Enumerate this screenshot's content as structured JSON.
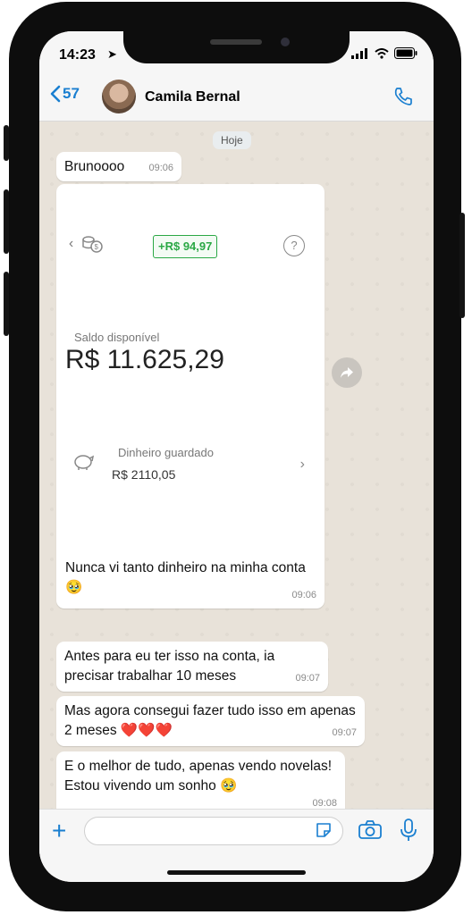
{
  "status": {
    "time": "14:23"
  },
  "header": {
    "back_count": "57",
    "contact_name": "Camila Bernal"
  },
  "chat": {
    "date_chip": "Hoje",
    "messages": [
      {
        "text": "Brunoooo",
        "time": "09:06"
      },
      {
        "text": "Nunca vi tanto dinheiro na minha conta 🥹",
        "time": "09:06"
      },
      {
        "text": "Antes para eu ter isso na conta, ia precisar trabalhar 10 meses",
        "time": "09:07"
      },
      {
        "text": "Mas agora consegui fazer tudo isso em apenas 2 meses ❤️❤️❤️",
        "time": "09:07"
      },
      {
        "text": "E o melhor de tudo, apenas vendo novelas! Estou vivendo um sonho 🥹",
        "time": "09:08"
      }
    ],
    "bank_card": {
      "badge": "+R$ 94,97",
      "help": "?",
      "saldo_label": "Saldo disponível",
      "saldo_value": "R$ 11.625,29",
      "guardado_label": "Dinheiro guardado",
      "guardado_value": "R$ 2110,05"
    }
  },
  "colors": {
    "accent": "#1a7fd0",
    "green": "#2aa845",
    "chat_bg": "#e8e2d9"
  },
  "icons": [
    "back-chevron-icon",
    "phone-call-icon",
    "plus-icon",
    "sticker-icon",
    "camera-icon",
    "mic-icon",
    "forward-icon",
    "piggy-bank-icon",
    "coins-icon"
  ]
}
